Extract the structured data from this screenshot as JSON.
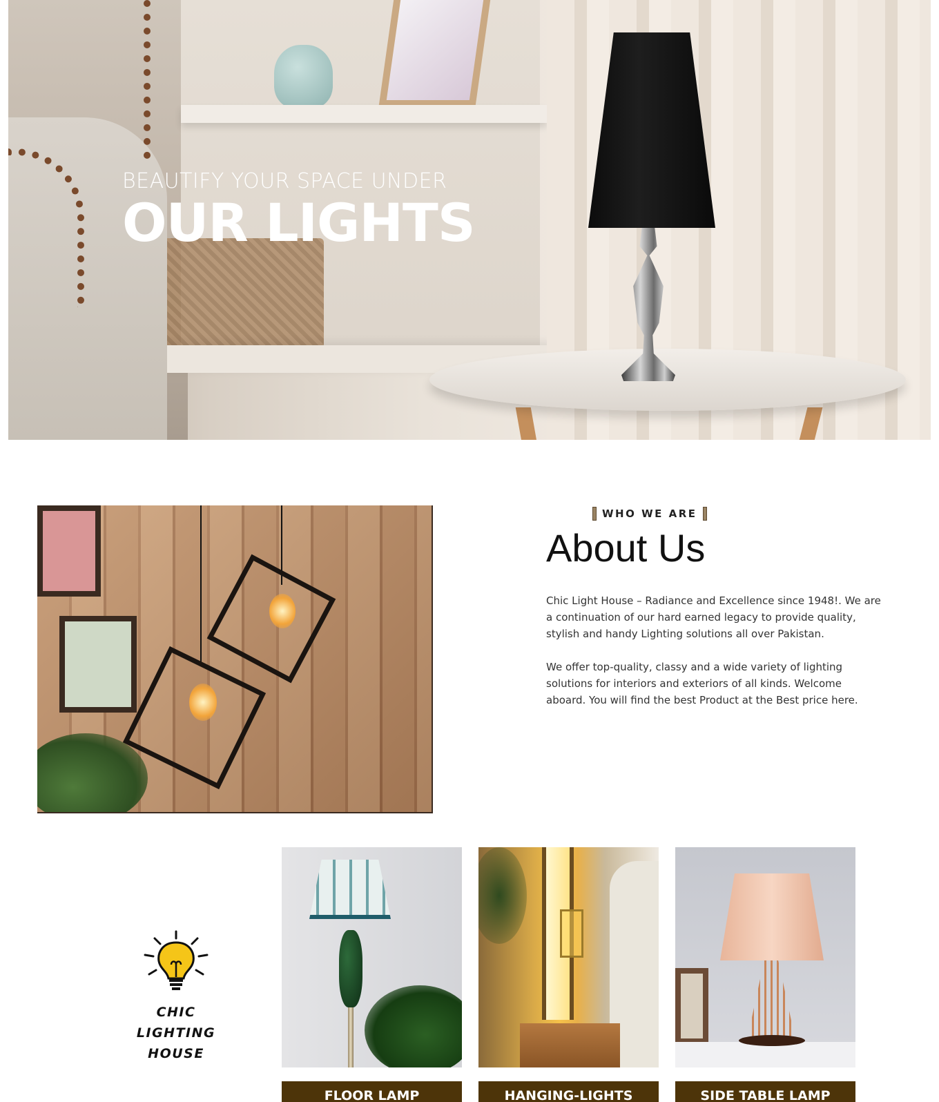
{
  "hero": {
    "subtitle": "BEAUTIFY YOUR SPACE UNDER",
    "title": "OUR LIGHTS"
  },
  "about": {
    "eyebrow": "WHO WE ARE",
    "title": "About Us",
    "paragraph1": "Chic Light House – Radiance and Excellence since 1948!. We are a continuation of our hard earned legacy to provide quality, stylish and handy Lighting solutions all over Pakistan.",
    "paragraph2": "We offer top-quality, classy and a wide variety of lighting solutions for interiors and exteriors of all kinds. Welcome aboard. You will find the best Product at the Best price here."
  },
  "brand": {
    "name_line1": "CHIC LIGHTING",
    "name_line2": "HOUSE",
    "icon": "lightbulb-icon"
  },
  "categories": [
    {
      "label": "FLOOR LAMP"
    },
    {
      "label": "HANGING-LIGHTS"
    },
    {
      "label": "SIDE TABLE LAMP"
    }
  ],
  "colors": {
    "category_label_bg": "#4d3409",
    "eyebrow_accent": "#9a8464",
    "bulb_yellow": "#f5c518"
  }
}
